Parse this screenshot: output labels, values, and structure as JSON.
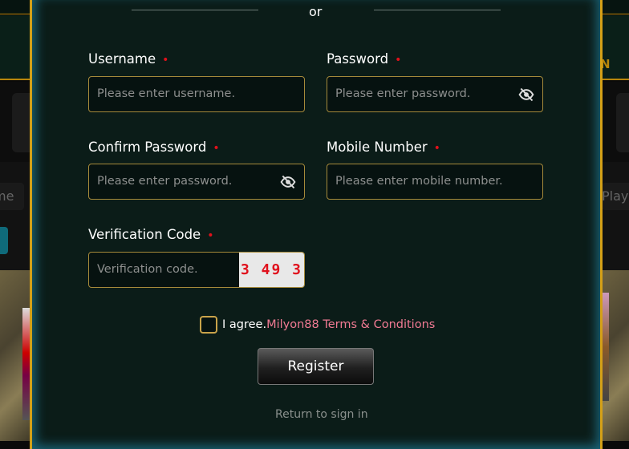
{
  "background": {
    "left_search_fragment": "me",
    "right_search_fragment": "Playe",
    "right_nav_fragment": "N"
  },
  "modal": {
    "divider_text": "or",
    "fields": [
      {
        "label": "Username",
        "placeholder": "Please enter username.",
        "required": true
      },
      {
        "label": "Password",
        "placeholder": "Please enter password.",
        "required": true,
        "icon": "eye-off-icon"
      },
      {
        "label": "Confirm Password",
        "placeholder": "Please enter password.",
        "required": true,
        "icon": "eye-off-icon"
      },
      {
        "label": "Mobile Number",
        "placeholder": "Please enter mobile number.",
        "required": true
      },
      {
        "label": "Verification Code",
        "placeholder": "Verification code.",
        "required": true,
        "captcha": "3 49 3"
      }
    ],
    "required_mark": "•",
    "agree_text": "I agree.",
    "terms_link": "Milyon88 Terms & Conditions",
    "register_label": "Register",
    "return_link": "Return to sign in",
    "colors": {
      "accent_gold": "#d4a017",
      "link_pink": "#f07a93",
      "required_red": "#e0111b",
      "panel_bg": "#0b1c18"
    }
  }
}
